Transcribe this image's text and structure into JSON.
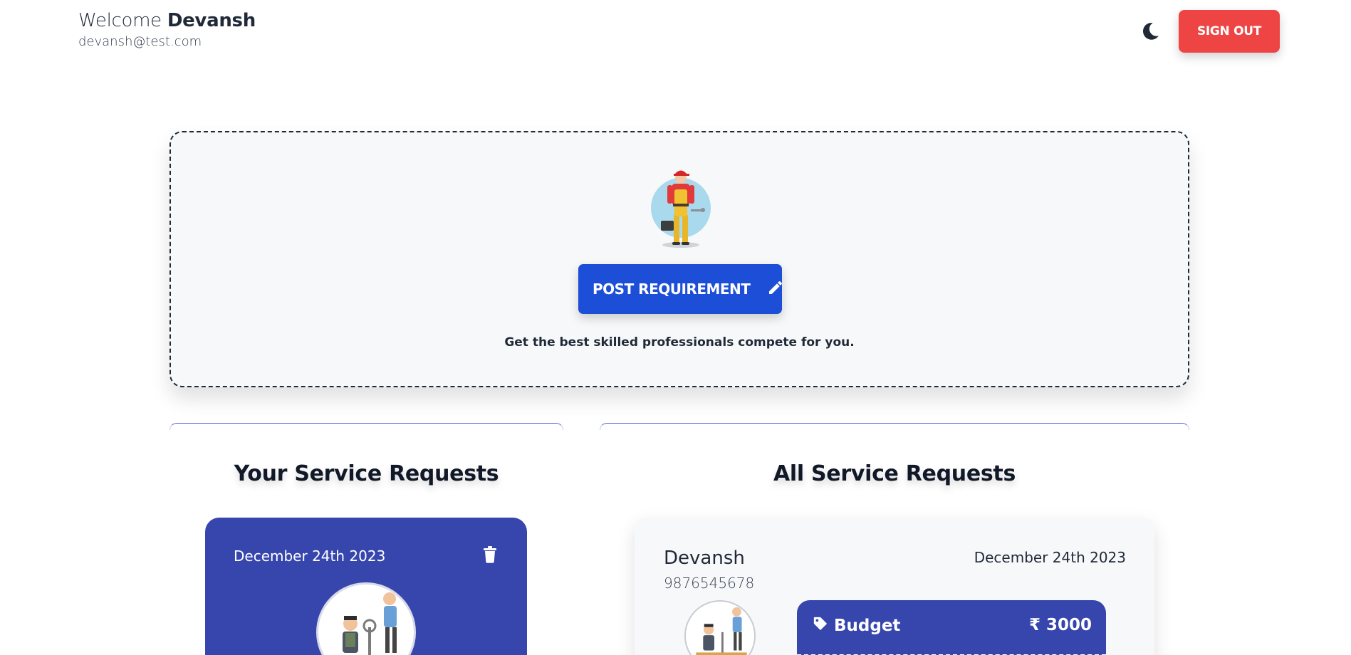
{
  "header": {
    "welcome_prefix": "Welcome",
    "user_name": "Devansh",
    "email": "devansh@test.com",
    "theme_icon": "moon-icon",
    "signout_label": "SIGN OUT"
  },
  "post": {
    "button_label": "POST REQUIREMENT",
    "button_icon": "pencil-icon",
    "tagline": "Get the best skilled professionals compete for you."
  },
  "your_requests": {
    "title": "Your Service Requests",
    "items": [
      {
        "date": "December 24th 2023"
      }
    ]
  },
  "all_requests": {
    "title": "All Service Requests",
    "items": [
      {
        "name": "Devansh",
        "phone": "9876545678",
        "date": "December 24th 2023",
        "budget_label": "Budget",
        "budget_value": "₹ 3000"
      }
    ]
  },
  "colors": {
    "primary": "#1d4ed8",
    "card_blue": "#3646ad",
    "danger": "#ef4444"
  }
}
